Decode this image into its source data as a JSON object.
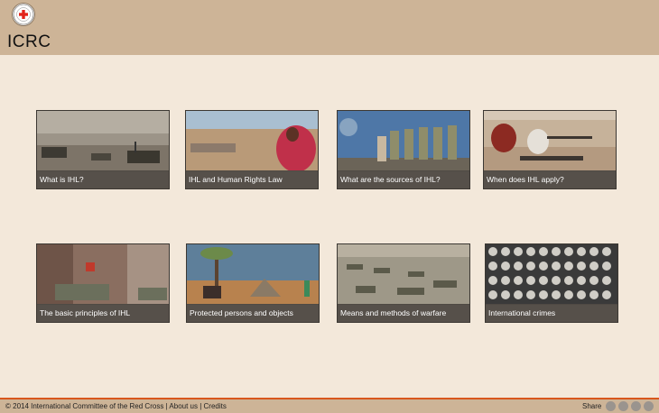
{
  "header": {
    "title": "ICRC"
  },
  "tiles": [
    {
      "label": "What is IHL?"
    },
    {
      "label": "IHL and Human Rights Law"
    },
    {
      "label": "What are the sources of IHL?"
    },
    {
      "label": "When does IHL apply?"
    },
    {
      "label": "The basic principles of IHL"
    },
    {
      "label": "Protected persons and objects"
    },
    {
      "label": "Means and methods of warfare"
    },
    {
      "label": "International crimes"
    }
  ],
  "footer": {
    "copyright": "© 2014 International Committee of the Red Cross",
    "sep1": " | ",
    "about": "About us",
    "sep2": " | ",
    "credits": "Credits",
    "share": "Share"
  },
  "social_icons": [
    "twitter-icon",
    "facebook-icon",
    "google-plus-icon",
    "more-icon"
  ],
  "colors": {
    "header_bg": "#cdb497",
    "page_bg": "#f3e8da",
    "footer_accent": "#d8561c",
    "caption_bg": "#56504a"
  }
}
